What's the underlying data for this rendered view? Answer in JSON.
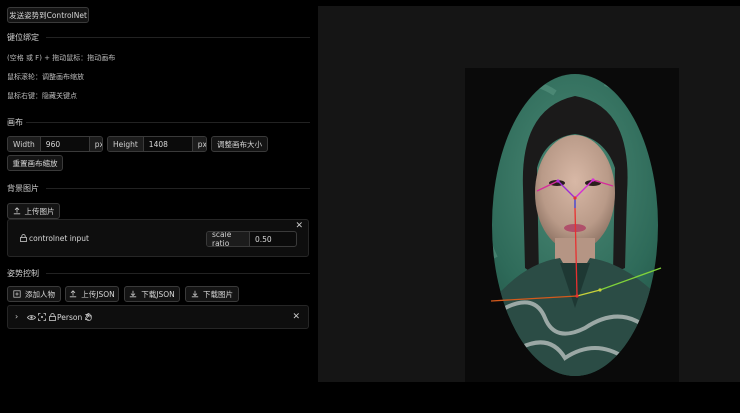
{
  "toolbar": {
    "send_pose": "发送姿势到ControlNet"
  },
  "keybind": {
    "title": "键位绑定",
    "lines": [
      "(空格 或 F) + 拖动鼠标：拖动画布",
      "鼠标滚轮：调整画布缩放",
      "鼠标右键：隐藏关键点"
    ]
  },
  "canvas": {
    "title": "画布",
    "width_label": "Width",
    "width_value": "960",
    "width_unit": "px",
    "height_label": "Height",
    "height_value": "1408",
    "height_unit": "px",
    "resize_button": "调整画布大小",
    "reset_zoom_button": "重置画布缩放"
  },
  "background": {
    "title": "背景图片",
    "upload_button": "上传图片",
    "controlnet_label": "controlnet input",
    "scale_label": "scale ratio",
    "scale_value": "0.50"
  },
  "pose": {
    "title": "姿势控制",
    "add_person": "添加人物",
    "upload_json": "上传JSON",
    "download_json": "下载JSON",
    "download_image": "下载图片",
    "person_label": "Person 2"
  },
  "colors": {
    "panel_bg": "#0e0e0e",
    "canvas_bg": "#111111",
    "portrait_green": "#2f6b5a"
  }
}
